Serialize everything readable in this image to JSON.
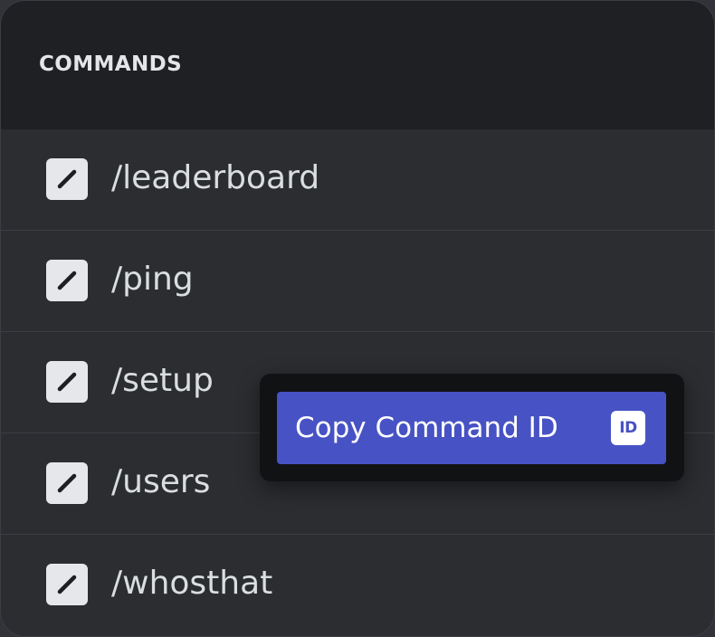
{
  "panel": {
    "title": "COMMANDS"
  },
  "commands": [
    {
      "label": "/leaderboard",
      "icon": "slash-icon"
    },
    {
      "label": "/ping",
      "icon": "slash-icon"
    },
    {
      "label": "/setup",
      "icon": "slash-icon"
    },
    {
      "label": "/users",
      "icon": "slash-icon"
    },
    {
      "label": "/whosthat",
      "icon": "slash-icon"
    }
  ],
  "context_menu": {
    "item_label": "Copy Command ID",
    "item_icon_text": "ID",
    "item_icon": "id-icon"
  },
  "colors": {
    "panel_bg": "#2b2d31",
    "header_bg": "#1f2023",
    "menu_bg": "#111214",
    "accent": "#4752c4",
    "text": "#dbdee1"
  }
}
